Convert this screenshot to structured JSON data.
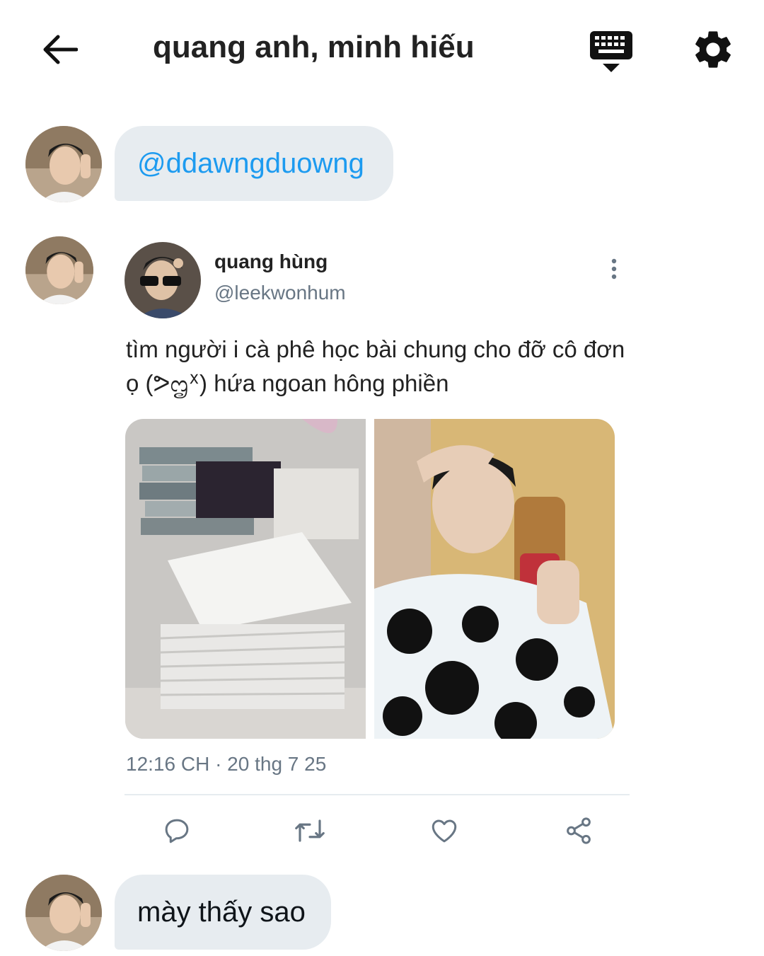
{
  "header": {
    "title": "quang anh, minh hiếu",
    "back_icon": "arrow-left-icon",
    "keyboard_icon": "keyboard-icon",
    "settings_icon": "gear-icon"
  },
  "messages": [
    {
      "type": "mention",
      "text": "@ddawngduowng"
    },
    {
      "type": "text",
      "text": "mày thấy sao"
    }
  ],
  "tweet": {
    "author_name": "quang hùng",
    "author_handle": "@leekwonhum",
    "text": "tìm người i cà phê học bài chung cho đỡ cô đơn ọ (ᕗᦗᕽ) hứa ngoan hông phiền",
    "timestamp": "12:16 CH · 20 thg 7 25",
    "media": [
      {
        "description": "stack of books and papers"
      },
      {
        "description": "mirror selfie in panda shirt"
      }
    ],
    "actions": [
      "reply-icon",
      "retweet-icon",
      "like-icon",
      "share-icon"
    ]
  },
  "colors": {
    "mention": "#1d9bf0",
    "bubble_bg": "#e7ecf0",
    "secondary_text": "#687684"
  }
}
